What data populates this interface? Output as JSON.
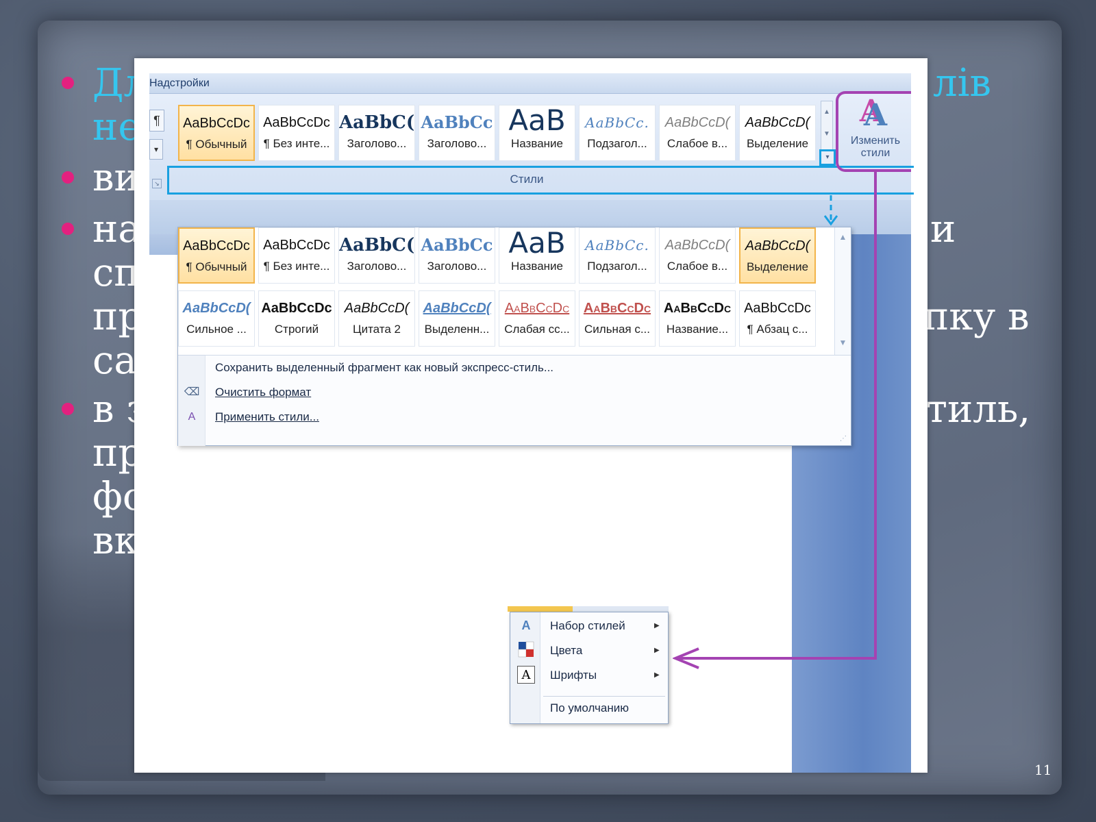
{
  "slide": {
    "number": "11",
    "bullets": [
      {
        "visible_left": "Дл",
        "visible_left_line2": "не",
        "visible_right": "лів",
        "accent": "#35c6ef"
      },
      {
        "visible_left": "ви"
      },
      {
        "visible_left": "на",
        "visible_left_line2": "сп",
        "visible_left_line3": "пр",
        "visible_left_line4": "са",
        "visible_right": "и",
        "visible_right_line3": "пку в"
      },
      {
        "visible_left": "в з",
        "visible_left_line2": "пр",
        "visible_left_line3": "фо",
        "visible_left_line4": "вк",
        "visible_right": "тиль,"
      }
    ],
    "bullet_color": "#e3217f"
  },
  "ribbon": {
    "tab_text": "Надстройки",
    "group_label": "Стили",
    "change_styles": {
      "line1": "Изменить",
      "line2": "стили"
    },
    "gallery": [
      {
        "sample": "AaBbCcDc",
        "label": "¶ Обычный",
        "selected": true,
        "style": "normal"
      },
      {
        "sample": "AaBbCcDc",
        "label": "¶ Без инте...",
        "style": "normal"
      },
      {
        "sample": "AaBbC(",
        "label": "Заголово...",
        "style": "h1"
      },
      {
        "sample": "AaBbCc",
        "label": "Заголово...",
        "style": "h2"
      },
      {
        "sample": "AaB",
        "label": "Название",
        "style": "title"
      },
      {
        "sample": "AaBbCc.",
        "label": "Подзагол...",
        "style": "sub"
      },
      {
        "sample": "AaBbCcD(",
        "label": "Слабое в...",
        "style": "weak"
      },
      {
        "sample": "AaBbCcD(",
        "label": "Выделение",
        "style": "em"
      }
    ]
  },
  "dropdown": {
    "row1": [
      {
        "sample": "AaBbCcDc",
        "label": "¶ Обычный",
        "selected": true,
        "style": "normal"
      },
      {
        "sample": "AaBbCcDc",
        "label": "¶ Без инте...",
        "style": "normal"
      },
      {
        "sample": "AaBbC(",
        "label": "Заголово...",
        "style": "h1"
      },
      {
        "sample": "AaBbCc",
        "label": "Заголово...",
        "style": "h2"
      },
      {
        "sample": "AaB",
        "label": "Название",
        "style": "title"
      },
      {
        "sample": "AaBbCc.",
        "label": "Подзагол...",
        "style": "sub"
      },
      {
        "sample": "AaBbCcD(",
        "label": "Слабое в...",
        "style": "weak"
      },
      {
        "sample": "AaBbCcD(",
        "label": "Выделение",
        "selected2": true,
        "style": "em"
      }
    ],
    "row2": [
      {
        "sample": "AaBbCcD(",
        "label": "Сильное ...",
        "style": "strong-em"
      },
      {
        "sample": "AaBbCcDc",
        "label": "Строгий",
        "style": "strong"
      },
      {
        "sample": "AaBbCcD(",
        "label": "Цитата 2",
        "style": "quote"
      },
      {
        "sample": "AaBbCcD(",
        "label": "Выделенн...",
        "style": "intense-quote"
      },
      {
        "sample": "AaBbCcDc",
        "label": "Слабая сс...",
        "style": "weak-ref"
      },
      {
        "sample": "AaBbCcDc",
        "label": "Сильная с...",
        "style": "strong-ref"
      },
      {
        "sample": "AaBbCcDc",
        "label": "Название...",
        "style": "book"
      },
      {
        "sample": "AaBbCcDc",
        "label": "¶ Абзац с...",
        "style": "normal"
      }
    ],
    "menu": {
      "save": "Сохранить выделенный фрагмент как новый экспресс-стиль...",
      "clear": "Очистить формат",
      "apply": "Применить стили..."
    }
  },
  "context_menu": {
    "items": [
      {
        "label": "Набор стилей",
        "submenu": true,
        "icon": "style-set-icon"
      },
      {
        "label": "Цвета",
        "submenu": true,
        "icon": "colors-icon"
      },
      {
        "label": "Шрифты",
        "submenu": true,
        "icon": "fonts-icon"
      },
      {
        "label": "По умолчанию",
        "submenu": false
      }
    ]
  },
  "colors": {
    "highlight_frame": "#18a0e0",
    "connector": "#a443b2"
  }
}
